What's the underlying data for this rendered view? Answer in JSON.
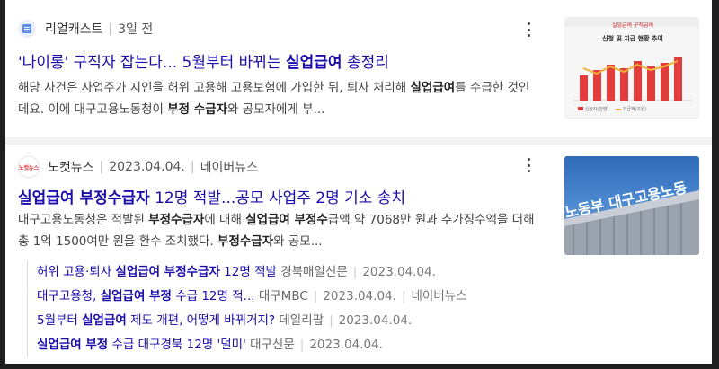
{
  "results": [
    {
      "source_name": "리얼캐스트",
      "source_time": "3일 전",
      "title": {
        "pre": "'나이롱' 구직자 잡는다... 5월부터 바뀌는 ",
        "bold": "실업급여",
        "post": " 총정리"
      },
      "snippet": {
        "p1": "해당 사건은 사업주가 지인을 허위 고용해 고용보험에 가입한 뒤, 퇴사 처리해 ",
        "b1": "실업급여",
        "p2": "를 수급한 것인데요. 이에 대구고용노동청이 ",
        "b2": "부정 수급자",
        "p3": "와 공모자에게 부..."
      },
      "thumbnail": {
        "caption_line1": "실업급여 구직급여",
        "caption_line2": "신청 및 지급 현황 추이",
        "legend1": "신청자(만명)",
        "legend2": "지급액(조원)"
      }
    },
    {
      "source_logo_text": "노컷뉴스",
      "source_name": "노컷뉴스",
      "source_date": "2023.04.04.",
      "source_portal": "네이버뉴스",
      "title": {
        "b1": "실업급여 부정수급자",
        "post": " 12명 적발...공모 사업주 2명 기소 송치"
      },
      "snippet": {
        "p1": "대구고용노동청은 적발된 ",
        "b1": "부정수급자",
        "p2": "에 대해 ",
        "b2": "실업급여 부정수",
        "p3": "급액 약 7068만 원과 추가징수액을 더해 총 1억 1500여만 원을 환수 조치했다. ",
        "b3": "부정수급자",
        "p4": "와 공모..."
      },
      "thumbnail": {
        "sign_text": "노동부 대구고용노동"
      },
      "related": [
        {
          "pre": "허위 고용·퇴사 ",
          "bold": "실업급여 부정수급자",
          "post": " 12명 적발",
          "press": "경북매일신문",
          "date": "2023.04.04."
        },
        {
          "pre": "대구고용청, ",
          "bold": "실업급여 부정",
          "post": " 수급 12명 적...",
          "press": "대구MBC",
          "date": "2023.04.04.",
          "portal": "네이버뉴스"
        },
        {
          "pre": "5월부터 ",
          "bold": "실업급여",
          "post": " 제도 개편, 어떻게 바뀌거지?",
          "press": "데일리팝",
          "date": "2023.04.04."
        },
        {
          "pre": "",
          "bold": "실업급여 부정",
          "post": " 수급 대구경북 12명 '덜미'",
          "press": "대구신문",
          "date": "2023.04.04."
        }
      ]
    }
  ],
  "colors": {
    "title_link": "#1a0dab",
    "chart_red": "#e33c3c",
    "chart_line": "#f2b233"
  },
  "icons": {
    "source1_logo": "document-icon",
    "more": "more-vertical-icon"
  }
}
